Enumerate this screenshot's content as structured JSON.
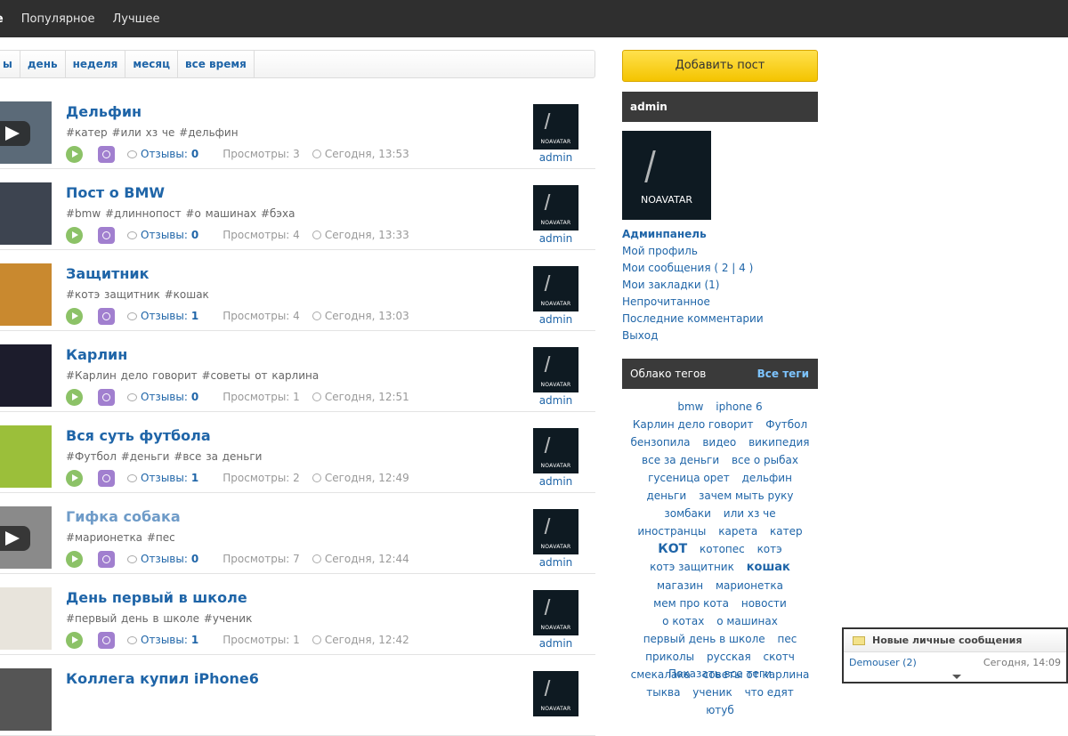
{
  "nav": {
    "items": [
      "ое",
      "Популярное",
      "Лучшее"
    ]
  },
  "filter": {
    "items": [
      "ы",
      "день",
      "неделя",
      "месяц",
      "все время"
    ]
  },
  "posts": [
    {
      "title": "Дельфин",
      "tags": "#катер #или хз че #дельфин",
      "reviews_label": "Отзывы:",
      "reviews": "0",
      "views": "Просмотры: 3",
      "time": "Сегодня, 13:53",
      "author": "admin",
      "visited": false,
      "thumb_color": "#5b6a78",
      "video": true
    },
    {
      "title": "Пост о BMW",
      "tags": "#bmw #длиннопост #о машинах #бэха",
      "reviews_label": "Отзывы:",
      "reviews": "0",
      "views": "Просмотры: 4",
      "time": "Сегодня, 13:33",
      "author": "admin",
      "visited": false,
      "thumb_color": "#3d4450",
      "video": false
    },
    {
      "title": "Защитник",
      "tags": "#котэ защитник #кошак",
      "reviews_label": "Отзывы:",
      "reviews": "1",
      "views": "Просмотры: 4",
      "time": "Сегодня, 13:03",
      "author": "admin",
      "visited": false,
      "thumb_color": "#c9892f",
      "video": false
    },
    {
      "title": "Карлин",
      "tags": "#Карлин дело говорит #советы от карлина",
      "reviews_label": "Отзывы:",
      "reviews": "0",
      "views": "Просмотры: 1",
      "time": "Сегодня, 12:51",
      "author": "admin",
      "visited": false,
      "thumb_color": "#1c1c2c",
      "video": false
    },
    {
      "title": "Вся суть футбола",
      "tags": "#Футбол #деньги #все за деньги",
      "reviews_label": "Отзывы:",
      "reviews": "1",
      "views": "Просмотры: 2",
      "time": "Сегодня, 12:49",
      "author": "admin",
      "visited": false,
      "thumb_color": "#9bbf3a",
      "video": false
    },
    {
      "title": "Гифка собака",
      "tags": "#марионетка #пес",
      "reviews_label": "Отзывы:",
      "reviews": "0",
      "views": "Просмотры: 7",
      "time": "Сегодня, 12:44",
      "author": "admin",
      "visited": true,
      "thumb_color": "#8a8a8a",
      "video": true
    },
    {
      "title": "День первый в школе",
      "tags": "#первый день в школе #ученик",
      "reviews_label": "Отзывы:",
      "reviews": "1",
      "views": "Просмотры: 1",
      "time": "Сегодня, 12:42",
      "author": "admin",
      "visited": false,
      "thumb_color": "#e8e4dc",
      "video": false
    },
    {
      "title": "Коллега купил iPhone6",
      "tags": "",
      "reviews_label": "",
      "reviews": "",
      "views": "",
      "time": "",
      "author": "",
      "visited": false,
      "thumb_color": "#555555",
      "video": false
    }
  ],
  "avatar_text": "NOAVATAR",
  "sidebar": {
    "add_post": "Добавить пост",
    "user_name": "admin",
    "menu": [
      "Админпанель",
      "Мой профиль",
      "Мои сообщения ( 2 | 4 )",
      "Мои закладки (1)",
      "Непрочитанное",
      "Последние комментарии",
      "Выход"
    ],
    "tags_title": "Облако тегов",
    "tags_all": "Все теги",
    "cloud": [
      {
        "t": "bmw",
        "s": ""
      },
      {
        "t": "iphone 6",
        "s": ""
      },
      {
        "t": "Карлин дело говорит",
        "s": ""
      },
      {
        "t": "Футбол",
        "s": ""
      },
      {
        "t": "бензопила",
        "s": ""
      },
      {
        "t": "видео",
        "s": ""
      },
      {
        "t": "википедия",
        "s": ""
      },
      {
        "t": "все за деньги",
        "s": ""
      },
      {
        "t": "все о рыбах",
        "s": ""
      },
      {
        "t": "гусеница орет",
        "s": ""
      },
      {
        "t": "дельфин",
        "s": ""
      },
      {
        "t": "деньги",
        "s": ""
      },
      {
        "t": "зачем мыть руку",
        "s": ""
      },
      {
        "t": "зомбаки",
        "s": ""
      },
      {
        "t": "или хз че",
        "s": ""
      },
      {
        "t": "иностранцы",
        "s": ""
      },
      {
        "t": "карета",
        "s": ""
      },
      {
        "t": "катер",
        "s": ""
      },
      {
        "t": "КОТ",
        "s": "big"
      },
      {
        "t": "котопес",
        "s": ""
      },
      {
        "t": "котэ",
        "s": ""
      },
      {
        "t": "котэ защитник",
        "s": ""
      },
      {
        "t": "кошак",
        "s": "mid"
      },
      {
        "t": "магазин",
        "s": ""
      },
      {
        "t": "марионетка",
        "s": ""
      },
      {
        "t": "мем про кота",
        "s": ""
      },
      {
        "t": "новости",
        "s": ""
      },
      {
        "t": "о котах",
        "s": ""
      },
      {
        "t": "о машинах",
        "s": ""
      },
      {
        "t": "первый день в школе",
        "s": ""
      },
      {
        "t": "пес",
        "s": ""
      },
      {
        "t": "приколы",
        "s": ""
      },
      {
        "t": "русская",
        "s": ""
      },
      {
        "t": "скотч",
        "s": ""
      },
      {
        "t": "смекалака",
        "s": ""
      },
      {
        "t": "советы от карлина",
        "s": ""
      },
      {
        "t": "тыква",
        "s": ""
      },
      {
        "t": "ученик",
        "s": ""
      },
      {
        "t": "что едят",
        "s": ""
      },
      {
        "t": "ютуб",
        "s": ""
      }
    ],
    "show_all_tags": "Показать все теги"
  },
  "notify": {
    "title": "Новые личные сообщения",
    "from": "Demouser (2)",
    "time": "Сегодня, 14:09"
  }
}
